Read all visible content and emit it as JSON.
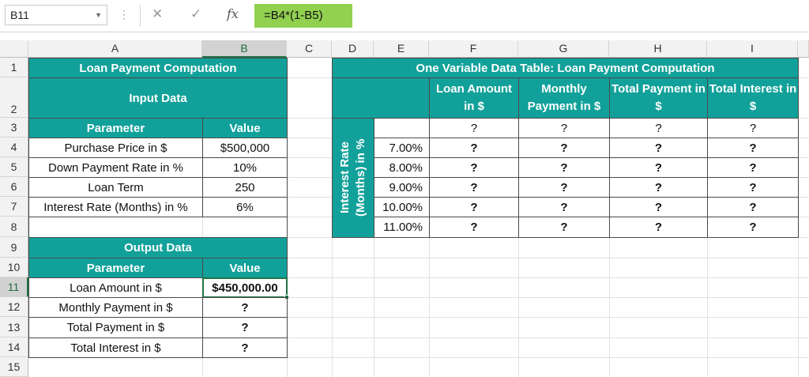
{
  "formula_bar": {
    "name_box": "B11",
    "formula": "=B4*(1-B5)",
    "fx": "fx",
    "cancel": "✕",
    "enter": "✓",
    "dots": "⋮"
  },
  "columns": [
    "A",
    "B",
    "C",
    "D",
    "E",
    "F",
    "G",
    "H",
    "I"
  ],
  "rows": [
    "1",
    "2",
    "3",
    "4",
    "5",
    "6",
    "7",
    "8",
    "9",
    "10",
    "11",
    "12",
    "13",
    "14",
    "15"
  ],
  "left": {
    "title": "Loan Payment Computation",
    "input_header": "Input Data",
    "param_header": "Parameter",
    "value_header": "Value",
    "inputs": [
      {
        "label": "Purchase Price in $",
        "value": "$500,000"
      },
      {
        "label": "Down Payment Rate in %",
        "value": "10%"
      },
      {
        "label": "Loan Term",
        "value": "250"
      },
      {
        "label": "Interest Rate (Months) in %",
        "value": "6%"
      }
    ],
    "output_header": "Output Data",
    "outputs": [
      {
        "label": "Loan Amount in $",
        "value": "$450,000.00"
      },
      {
        "label": "Monthly Payment in $",
        "value": "?"
      },
      {
        "label": "Total Payment in $",
        "value": "?"
      },
      {
        "label": "Total Interest in $",
        "value": "?"
      }
    ]
  },
  "table": {
    "title": "One Variable Data Table: Loan Payment Computation",
    "headers": [
      "Loan Amount in $",
      "Monthly Payment in $",
      "Total Payment in $",
      "Total Interest in $"
    ],
    "side_label": "Interest Rate (Months) in %",
    "row3": [
      "?",
      "?",
      "?",
      "?"
    ],
    "rates": [
      "7.00%",
      "8.00%",
      "9.00%",
      "10.00%",
      "11.00%"
    ],
    "cell_value": "?"
  }
}
